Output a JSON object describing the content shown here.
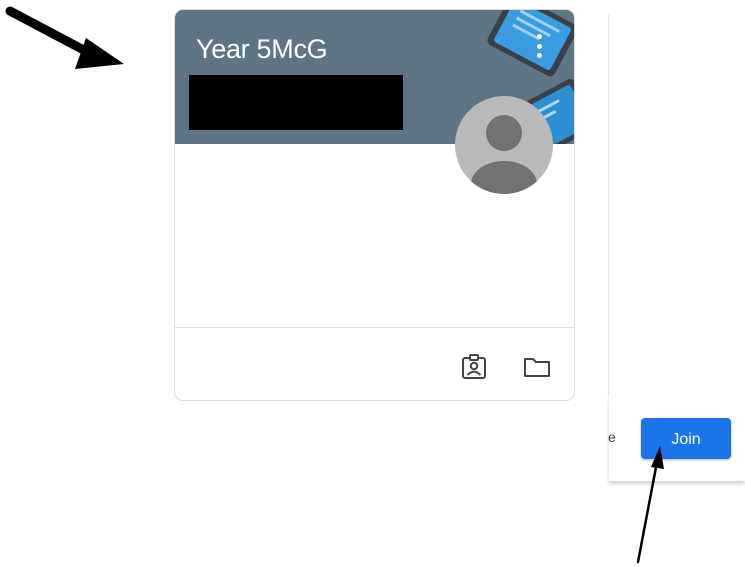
{
  "class_card": {
    "title": "Year 5McG",
    "header_color": "#5f7583",
    "more_icon": "more-vert-icon",
    "footer_icons": [
      "portfolio-icon",
      "folder-icon"
    ]
  },
  "join_dialog": {
    "cut_text": "e",
    "join_label": "Join",
    "join_color": "#1a73e8"
  }
}
